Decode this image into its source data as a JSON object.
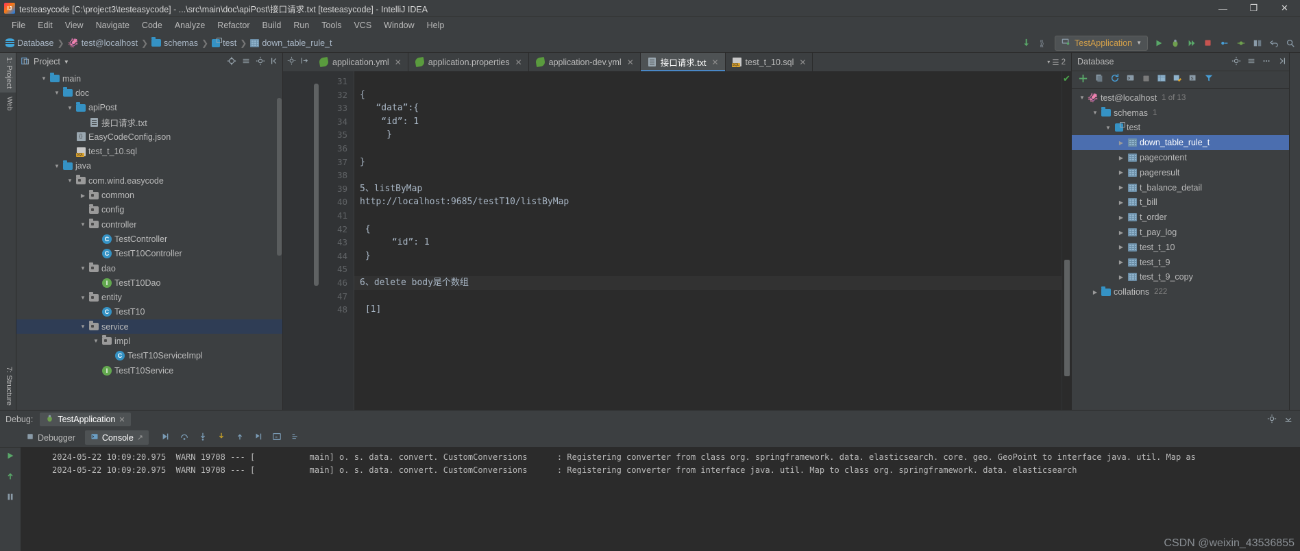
{
  "window": {
    "title": "testeasycode [C:\\project3\\testeasycode] - ...\\src\\main\\doc\\apiPost\\接口请求.txt [testeasycode] - IntelliJ IDEA",
    "minimize": "—",
    "maximize": "❐",
    "close": "✕"
  },
  "menu": [
    "File",
    "Edit",
    "View",
    "Navigate",
    "Code",
    "Analyze",
    "Refactor",
    "Build",
    "Run",
    "Tools",
    "VCS",
    "Window",
    "Help"
  ],
  "navbar": {
    "crumbs": [
      {
        "label": "Database",
        "icon": "database-icon"
      },
      {
        "label": "test@localhost",
        "icon": "mysql-dolphin-icon"
      },
      {
        "label": "schemas",
        "icon": "folder-icon"
      },
      {
        "label": "test",
        "icon": "schema-icon"
      },
      {
        "label": "down_table_rule_t",
        "icon": "table-icon"
      }
    ],
    "separator": "❯",
    "run_config": "TestApplication",
    "dropdown_caret": "▼"
  },
  "left_strip": {
    "project_tab": "1: Project",
    "structure_tab": "7: Structure",
    "web_tab": "Web"
  },
  "project": {
    "title": "Project",
    "caret": "▼",
    "items": [
      {
        "label": "main",
        "indent": 1,
        "twist": "▼",
        "icon": "folder-icon",
        "selected": false
      },
      {
        "label": "doc",
        "indent": 2,
        "twist": "▼",
        "icon": "folder-icon",
        "selected": false
      },
      {
        "label": "apiPost",
        "indent": 3,
        "twist": "▼",
        "icon": "folder-icon",
        "selected": false
      },
      {
        "label": "接口请求.txt",
        "indent": 4,
        "twist": "",
        "icon": "text-file-icon",
        "selected": false
      },
      {
        "label": "EasyCodeConfig.json",
        "indent": 3,
        "twist": "",
        "icon": "json-file-icon",
        "selected": false
      },
      {
        "label": "test_t_10.sql",
        "indent": 3,
        "twist": "",
        "icon": "sql-file-icon",
        "selected": false
      },
      {
        "label": "java",
        "indent": 2,
        "twist": "▼",
        "icon": "source-folder-icon",
        "selected": false
      },
      {
        "label": "com.wind.easycode",
        "indent": 3,
        "twist": "▼",
        "icon": "package-icon",
        "selected": false
      },
      {
        "label": "common",
        "indent": 4,
        "twist": "▶",
        "icon": "package-icon",
        "selected": false
      },
      {
        "label": "config",
        "indent": 4,
        "twist": "",
        "icon": "package-icon",
        "selected": false
      },
      {
        "label": "controller",
        "indent": 4,
        "twist": "▼",
        "icon": "package-icon",
        "selected": false
      },
      {
        "label": "TestController",
        "indent": 5,
        "twist": "",
        "icon": "class-icon",
        "selected": false
      },
      {
        "label": "TestT10Controller",
        "indent": 5,
        "twist": "",
        "icon": "class-icon",
        "selected": false
      },
      {
        "label": "dao",
        "indent": 4,
        "twist": "▼",
        "icon": "package-icon",
        "selected": false
      },
      {
        "label": "TestT10Dao",
        "indent": 5,
        "twist": "",
        "icon": "interface-icon",
        "selected": false
      },
      {
        "label": "entity",
        "indent": 4,
        "twist": "▼",
        "icon": "package-icon",
        "selected": false
      },
      {
        "label": "TestT10",
        "indent": 5,
        "twist": "",
        "icon": "class-icon",
        "selected": false
      },
      {
        "label": "service",
        "indent": 4,
        "twist": "▼",
        "icon": "package-icon",
        "selected": true
      },
      {
        "label": "impl",
        "indent": 5,
        "twist": "▼",
        "icon": "package-icon",
        "selected": false
      },
      {
        "label": "TestT10ServiceImpl",
        "indent": 6,
        "twist": "",
        "icon": "class-icon",
        "selected": false
      },
      {
        "label": "TestT10Service",
        "indent": 5,
        "twist": "",
        "icon": "interface-icon",
        "selected": false
      }
    ]
  },
  "editor": {
    "tabs": [
      {
        "label": "application.yml",
        "icon": "spring-leaf-icon",
        "active": false,
        "close": "✕"
      },
      {
        "label": "application.properties",
        "icon": "spring-leaf-icon",
        "active": false,
        "close": "✕"
      },
      {
        "label": "application-dev.yml",
        "icon": "spring-leaf-icon",
        "active": false,
        "close": "✕"
      },
      {
        "label": "接口请求.txt",
        "icon": "text-file-icon",
        "active": true,
        "close": "✕"
      },
      {
        "label": "test_t_10.sql",
        "icon": "sql-file-icon",
        "active": false,
        "close": "✕"
      }
    ],
    "tab_overflow_count": "2",
    "inspection_status": "✔",
    "lines": [
      {
        "num": "31",
        "text": "",
        "highlight": false
      },
      {
        "num": "32",
        "text": "{",
        "highlight": false
      },
      {
        "num": "33",
        "text": "   “data”:{",
        "highlight": false
      },
      {
        "num": "34",
        "text": "    “id”: 1",
        "highlight": false
      },
      {
        "num": "35",
        "text": "     }",
        "highlight": false
      },
      {
        "num": "36",
        "text": "",
        "highlight": false
      },
      {
        "num": "37",
        "text": "}",
        "highlight": false
      },
      {
        "num": "38",
        "text": "",
        "highlight": false
      },
      {
        "num": "39",
        "text": "5、listByMap",
        "highlight": false
      },
      {
        "num": "40",
        "text": "http://localhost:9685/testT10/listByMap",
        "highlight": false
      },
      {
        "num": "41",
        "text": "",
        "highlight": false
      },
      {
        "num": "42",
        "text": " {",
        "highlight": false
      },
      {
        "num": "43",
        "text": "      “id”: 1",
        "highlight": false
      },
      {
        "num": "44",
        "text": " }",
        "highlight": false
      },
      {
        "num": "45",
        "text": "",
        "highlight": false
      },
      {
        "num": "46",
        "text": "6、delete body是个数组",
        "highlight": true
      },
      {
        "num": "47",
        "text": "",
        "highlight": false
      },
      {
        "num": "48",
        "text": " [1]",
        "highlight": false
      }
    ]
  },
  "database": {
    "title": "Database",
    "toolbar_icons": [
      "add-icon",
      "copy-icon",
      "refresh-icon",
      "db-console-icon",
      "stop-icon",
      "table-editor-icon",
      "modify-icon",
      "jump-icon",
      "filter-icon"
    ],
    "items": [
      {
        "label": "test@localhost",
        "count": "1 of 13",
        "indent": 0,
        "twist": "▼",
        "icon": "mysql-dolphin-icon",
        "selected": false
      },
      {
        "label": "schemas",
        "count": "1",
        "indent": 1,
        "twist": "▼",
        "icon": "folder-icon",
        "selected": false
      },
      {
        "label": "test",
        "count": "",
        "indent": 2,
        "twist": "▼",
        "icon": "schema-icon",
        "selected": false
      },
      {
        "label": "down_table_rule_t",
        "count": "",
        "indent": 3,
        "twist": "▶",
        "icon": "table-icon",
        "selected": true
      },
      {
        "label": "pagecontent",
        "count": "",
        "indent": 3,
        "twist": "▶",
        "icon": "table-icon",
        "selected": false
      },
      {
        "label": "pageresult",
        "count": "",
        "indent": 3,
        "twist": "▶",
        "icon": "table-icon",
        "selected": false
      },
      {
        "label": "t_balance_detail",
        "count": "",
        "indent": 3,
        "twist": "▶",
        "icon": "table-icon",
        "selected": false
      },
      {
        "label": "t_bill",
        "count": "",
        "indent": 3,
        "twist": "▶",
        "icon": "table-icon",
        "selected": false
      },
      {
        "label": "t_order",
        "count": "",
        "indent": 3,
        "twist": "▶",
        "icon": "table-icon",
        "selected": false
      },
      {
        "label": "t_pay_log",
        "count": "",
        "indent": 3,
        "twist": "▶",
        "icon": "table-icon",
        "selected": false
      },
      {
        "label": "test_t_10",
        "count": "",
        "indent": 3,
        "twist": "▶",
        "icon": "table-icon",
        "selected": false
      },
      {
        "label": "test_t_9",
        "count": "",
        "indent": 3,
        "twist": "▶",
        "icon": "table-icon",
        "selected": false
      },
      {
        "label": "test_t_9_copy",
        "count": "",
        "indent": 3,
        "twist": "▶",
        "icon": "table-icon",
        "selected": false
      },
      {
        "label": "collations",
        "count": "222",
        "indent": 1,
        "twist": "▶",
        "icon": "folder-icon",
        "selected": false
      }
    ]
  },
  "debug": {
    "title": "Debug:",
    "session_tab": "TestApplication",
    "session_close": "✕",
    "subtabs": [
      {
        "label": "Debugger",
        "icon": "debugger-icon",
        "active": false
      },
      {
        "label": "Console",
        "icon": "console-icon",
        "active": true
      }
    ],
    "console_lines": [
      "2024-05-22 10:09:20.975  WARN 19708 --- [           main] o. s. data. convert. CustomConversions      : Registering converter from class org. springframework. data. elasticsearch. core. geo. GeoPoint to interface java. util. Map as",
      "2024-05-22 10:09:20.975  WARN 19708 --- [           main] o. s. data. convert. CustomConversions      : Registering converter from interface java. util. Map to class org. springframework. data. elasticsearch"
    ]
  },
  "watermark": "CSDN @weixin_43536855"
}
